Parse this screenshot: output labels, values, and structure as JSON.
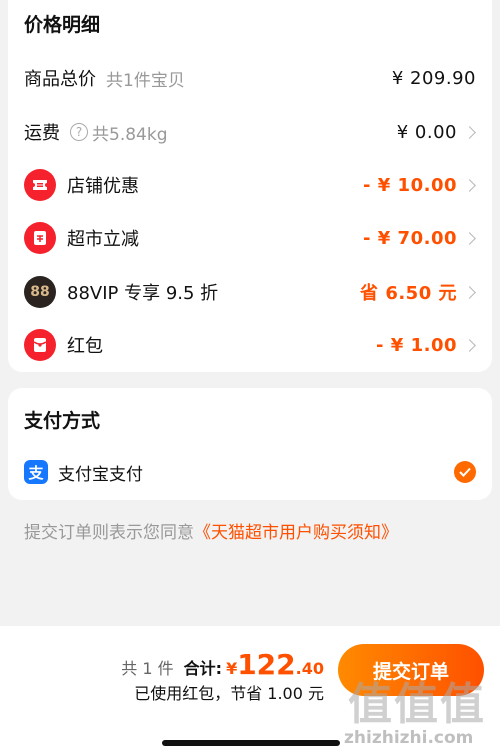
{
  "price_section": {
    "title": "价格明细",
    "subtotal": {
      "label": "商品总价",
      "sub": "共1件宝贝",
      "value": "¥ 209.90"
    },
    "shipping": {
      "label": "运费",
      "help_icon": "question-circle-icon",
      "sub": "共5.84kg",
      "value": "¥ 0.00"
    },
    "discounts": [
      {
        "icon": "shop-coupon-icon",
        "label": "店铺优惠",
        "value": "- ¥ 10.00"
      },
      {
        "icon": "supermarket-discount-icon",
        "label": "超市立减",
        "value": "- ¥ 70.00"
      },
      {
        "icon": "88vip-icon",
        "icon_text": "88",
        "label": "88VIP 专享 9.5 折",
        "value": "省 6.50 元"
      },
      {
        "icon": "red-packet-icon",
        "label": "红包",
        "value": "- ¥ 1.00"
      }
    ]
  },
  "payment": {
    "title": "支付方式",
    "method": {
      "icon": "alipay-icon",
      "icon_text": "支",
      "label": "支付宝支付",
      "selected": true
    }
  },
  "agreement": {
    "text": "提交订单则表示您同意",
    "link": "《天猫超市用户购买须知》"
  },
  "footer": {
    "count": "共 1 件",
    "total_label": "合计:",
    "currency": "¥",
    "total_int": "122",
    "total_dec": ".40",
    "saving": "已使用红包，节省 1.00 元",
    "submit_label": "提交订单"
  },
  "watermark": {
    "text": "值值值",
    "url": "zhizhizhi.com"
  },
  "colors": {
    "accent": "#ff5000",
    "badge_red": "#f5222d",
    "alipay_blue": "#1677ff",
    "vip_dark": "#2a2320"
  }
}
